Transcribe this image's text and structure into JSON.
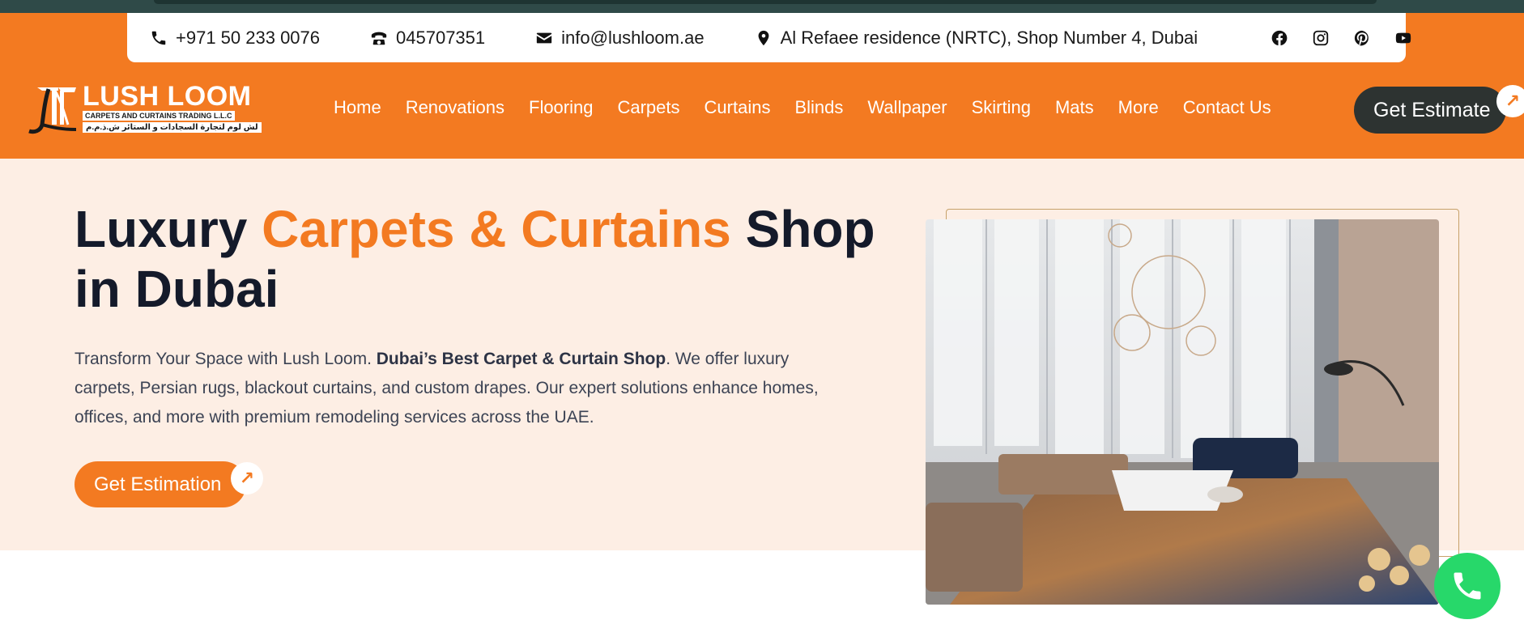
{
  "contact": {
    "phone": "+971 50 233 0076",
    "landline": "045707351",
    "email": "info@lushloom.ae",
    "address": "Al Refaee residence (NRTC), Shop Number 4, Dubai"
  },
  "social": [
    "facebook-icon",
    "instagram-icon",
    "pinterest-icon",
    "youtube-icon"
  ],
  "logo": {
    "brand": "LUSH LOOM",
    "tagline": "CARPETS AND CURTAINS TRADING L.L.C",
    "arabic": "لش لوم لتجارة السجادات و الستائر ش.ذ.م.م"
  },
  "nav": {
    "items": [
      "Home",
      "Renovations",
      "Flooring",
      "Carpets",
      "Curtains",
      "Blinds",
      "Wallpaper",
      "Skirting",
      "Mats",
      "More",
      "Contact Us"
    ],
    "cta": "Get Estimate"
  },
  "hero": {
    "title_part1": "Luxury ",
    "title_accent": "Carpets & Curtains",
    "title_part2": " Shop in Dubai",
    "desc_part1": "Transform Your Space with Lush Loom. ",
    "desc_bold": "Dubai’s Best Carpet & Curtain Shop",
    "desc_part2": ". We offer luxury carpets, Persian rugs, blackout curtains, and custom drapes. Our expert solutions enhance homes, offices, and more with premium remodeling services across the UAE.",
    "cta": "Get Estimation"
  },
  "colors": {
    "accent": "#f37a21",
    "dark": "#2d3331",
    "hero_bg": "#fdeee4",
    "fab": "#27d86a"
  }
}
